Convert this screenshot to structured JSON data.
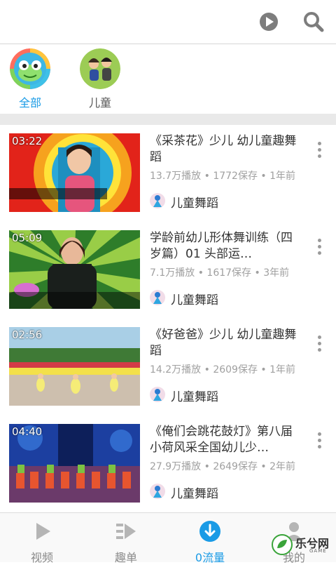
{
  "header": {
    "play_icon": "play-circle-icon",
    "search_icon": "search-icon"
  },
  "categories": [
    {
      "label": "全部",
      "active": true
    },
    {
      "label": "儿童",
      "active": false
    }
  ],
  "videos": [
    {
      "duration": "03:22",
      "title": "《采茶花》少儿 幼儿童趣舞蹈",
      "meta": "13.7万播放 • 1772保存 • 1年前",
      "author": "儿童舞蹈"
    },
    {
      "duration": "05:09",
      "title": "学龄前幼儿形体舞训练（四岁篇）01 头部运…",
      "meta": "7.1万播放 • 1617保存 • 3年前",
      "author": "儿童舞蹈"
    },
    {
      "duration": "02:56",
      "title": "《好爸爸》少儿 幼儿童趣舞蹈",
      "meta": "14.2万播放 • 2609保存 • 1年前",
      "author": "儿童舞蹈"
    },
    {
      "duration": "04:40",
      "title": "《俺们会跳花鼓灯》第八届小荷风采全国幼儿少…",
      "meta": "27.9万播放 • 2649保存 • 2年前",
      "author": "儿童舞蹈"
    }
  ],
  "bottom_nav": [
    {
      "label": "视频",
      "active": false
    },
    {
      "label": "趣单",
      "active": false
    },
    {
      "label": "0流量",
      "active": true
    },
    {
      "label": "我的",
      "active": false
    }
  ],
  "watermark": {
    "text": "乐兮网",
    "sub": "GAME"
  },
  "colors": {
    "accent": "#1a9be6",
    "divider": "#e9e9e9",
    "meta_text": "#a0a0a0"
  }
}
